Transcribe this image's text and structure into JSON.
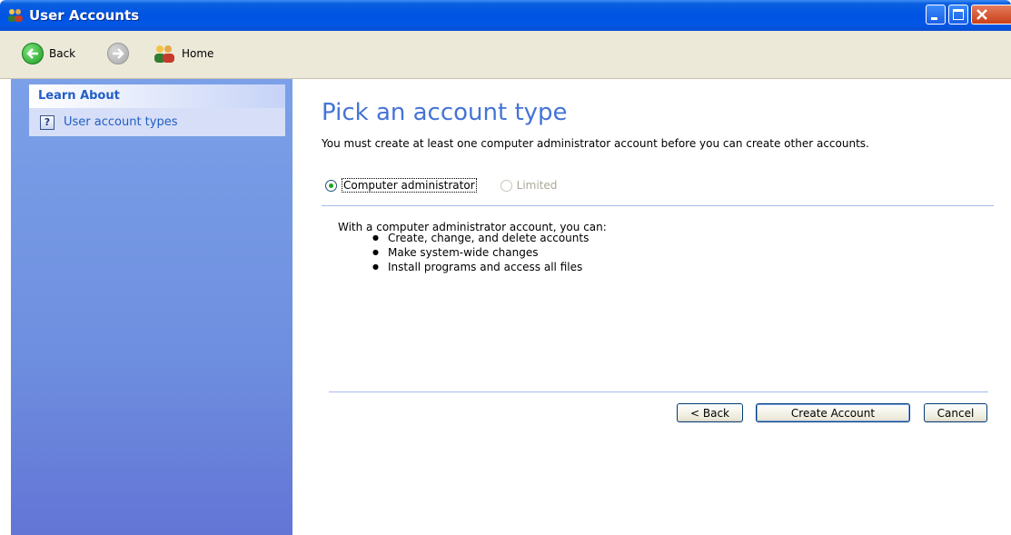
{
  "window": {
    "title": "User Accounts"
  },
  "toolbar": {
    "back_label": "Back",
    "home_label": "Home"
  },
  "sidebar": {
    "panel_title": "Learn About",
    "items": [
      {
        "label": "User account types",
        "icon": "help-icon"
      }
    ]
  },
  "main": {
    "heading": "Pick an account type",
    "intro": "You must create at least one computer administrator account before you can create other accounts.",
    "options": [
      {
        "label": "Computer administrator",
        "selected": true,
        "enabled": true
      },
      {
        "label": "Limited",
        "selected": false,
        "enabled": false
      }
    ],
    "description": "With a computer administrator account, you can:",
    "bullets": [
      "Create, change, and delete accounts",
      "Make system-wide changes",
      "Install programs and access all files"
    ]
  },
  "buttons": {
    "back": "< Back",
    "create": "Create Account",
    "cancel": "Cancel"
  },
  "colors": {
    "titlebar": "#0054e3",
    "heading": "#4574d6",
    "sidebar": "#6e8fdf",
    "link": "#215dc6"
  }
}
